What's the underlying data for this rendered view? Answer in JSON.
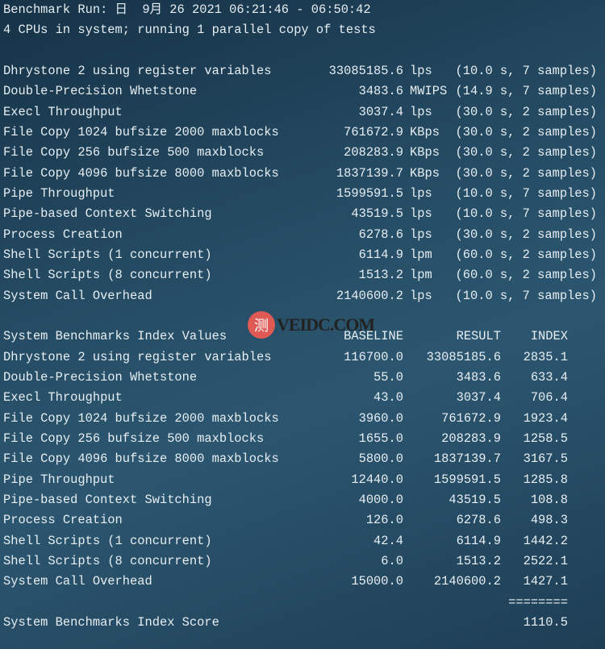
{
  "header": {
    "run_line": "Benchmark Run: 日  9月 26 2021 06:21:46 - 06:50:42",
    "cpu_line": "4 CPUs in system; running 1 parallel copy of tests"
  },
  "results": [
    {
      "name": "Dhrystone 2 using register variables",
      "value": "33085185.6",
      "unit": "lps",
      "samples": "(10.0 s, 7 samples)"
    },
    {
      "name": "Double-Precision Whetstone",
      "value": "3483.6",
      "unit": "MWIPS",
      "samples": "(14.9 s, 7 samples)"
    },
    {
      "name": "Execl Throughput",
      "value": "3037.4",
      "unit": "lps",
      "samples": "(30.0 s, 2 samples)"
    },
    {
      "name": "File Copy 1024 bufsize 2000 maxblocks",
      "value": "761672.9",
      "unit": "KBps",
      "samples": "(30.0 s, 2 samples)"
    },
    {
      "name": "File Copy 256 bufsize 500 maxblocks",
      "value": "208283.9",
      "unit": "KBps",
      "samples": "(30.0 s, 2 samples)"
    },
    {
      "name": "File Copy 4096 bufsize 8000 maxblocks",
      "value": "1837139.7",
      "unit": "KBps",
      "samples": "(30.0 s, 2 samples)"
    },
    {
      "name": "Pipe Throughput",
      "value": "1599591.5",
      "unit": "lps",
      "samples": "(10.0 s, 7 samples)"
    },
    {
      "name": "Pipe-based Context Switching",
      "value": "43519.5",
      "unit": "lps",
      "samples": "(10.0 s, 7 samples)"
    },
    {
      "name": "Process Creation",
      "value": "6278.6",
      "unit": "lps",
      "samples": "(30.0 s, 2 samples)"
    },
    {
      "name": "Shell Scripts (1 concurrent)",
      "value": "6114.9",
      "unit": "lpm",
      "samples": "(60.0 s, 2 samples)"
    },
    {
      "name": "Shell Scripts (8 concurrent)",
      "value": "1513.2",
      "unit": "lpm",
      "samples": "(60.0 s, 2 samples)"
    },
    {
      "name": "System Call Overhead",
      "value": "2140600.2",
      "unit": "lps",
      "samples": "(10.0 s, 7 samples)"
    }
  ],
  "index_table": {
    "title": "System Benchmarks Index Values",
    "col_baseline": "BASELINE",
    "col_result": "RESULT",
    "col_index": "INDEX",
    "rows": [
      {
        "name": "Dhrystone 2 using register variables",
        "baseline": "116700.0",
        "result": "33085185.6",
        "index": "2835.1"
      },
      {
        "name": "Double-Precision Whetstone",
        "baseline": "55.0",
        "result": "3483.6",
        "index": "633.4"
      },
      {
        "name": "Execl Throughput",
        "baseline": "43.0",
        "result": "3037.4",
        "index": "706.4"
      },
      {
        "name": "File Copy 1024 bufsize 2000 maxblocks",
        "baseline": "3960.0",
        "result": "761672.9",
        "index": "1923.4"
      },
      {
        "name": "File Copy 256 bufsize 500 maxblocks",
        "baseline": "1655.0",
        "result": "208283.9",
        "index": "1258.5"
      },
      {
        "name": "File Copy 4096 bufsize 8000 maxblocks",
        "baseline": "5800.0",
        "result": "1837139.7",
        "index": "3167.5"
      },
      {
        "name": "Pipe Throughput",
        "baseline": "12440.0",
        "result": "1599591.5",
        "index": "1285.8"
      },
      {
        "name": "Pipe-based Context Switching",
        "baseline": "4000.0",
        "result": "43519.5",
        "index": "108.8"
      },
      {
        "name": "Process Creation",
        "baseline": "126.0",
        "result": "6278.6",
        "index": "498.3"
      },
      {
        "name": "Shell Scripts (1 concurrent)",
        "baseline": "42.4",
        "result": "6114.9",
        "index": "1442.2"
      },
      {
        "name": "Shell Scripts (8 concurrent)",
        "baseline": "6.0",
        "result": "1513.2",
        "index": "2522.1"
      },
      {
        "name": "System Call Overhead",
        "baseline": "15000.0",
        "result": "2140600.2",
        "index": "1427.1"
      }
    ],
    "separator": "========",
    "score_label": "System Benchmarks Index Score",
    "score": "1110.5"
  },
  "watermark": {
    "logo_glyph": "测",
    "text": "VEIDC.COM"
  }
}
